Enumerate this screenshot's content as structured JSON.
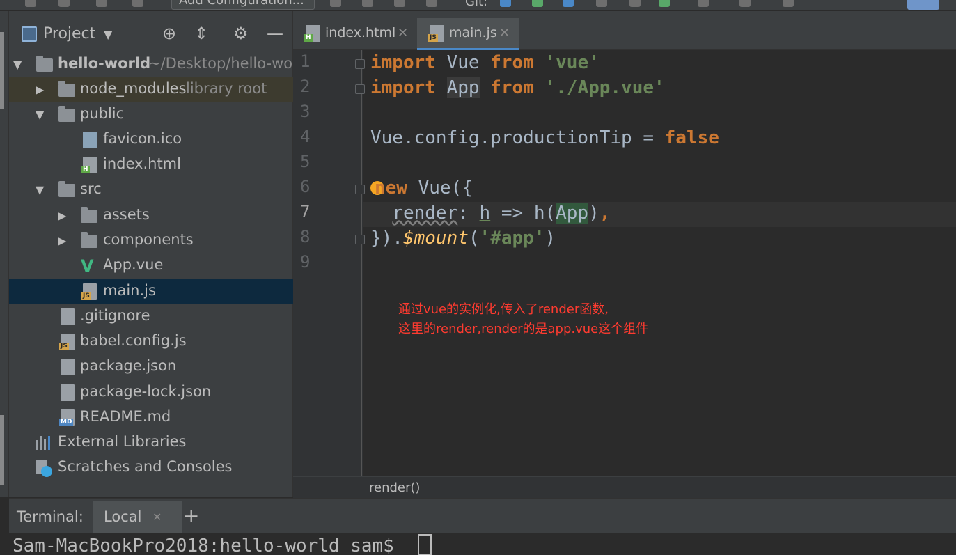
{
  "toolbar": {
    "run_config": "Add Configuration...",
    "git_label": "Git:"
  },
  "project": {
    "title": "Project",
    "tree": {
      "root": {
        "label": "hello-world",
        "hint": "~/Desktop/hello-worl"
      },
      "node_modules": {
        "label": "node_modules",
        "hint": "library root"
      },
      "public": "public",
      "favicon": "favicon.ico",
      "index_html": "index.html",
      "src": "src",
      "assets": "assets",
      "components": "components",
      "app_vue": "App.vue",
      "main_js": "main.js",
      "gitignore": ".gitignore",
      "babel": "babel.config.js",
      "package": "package.json",
      "package_lock": "package-lock.json",
      "readme": "README.md",
      "external": "External Libraries",
      "scratches": "Scratches and Consoles"
    },
    "badges": {
      "js": "JS",
      "h": "H",
      "md": "MD"
    }
  },
  "tabs": [
    {
      "label": "index.html"
    },
    {
      "label": "main.js"
    }
  ],
  "editor": {
    "line_numbers": [
      "1",
      "2",
      "3",
      "4",
      "5",
      "6",
      "7",
      "8",
      "9"
    ],
    "code": {
      "l1": {
        "kw1": "import",
        "id": "Vue",
        "kw2": "from",
        "str": "'vue'"
      },
      "l2": {
        "kw1": "import",
        "id": "App",
        "kw2": "from",
        "str": "'./App.vue'"
      },
      "l4": {
        "expr": "Vue.config.productionTip = ",
        "kw": "false"
      },
      "l6": {
        "kw_start": "n",
        "kw_rest": "ew",
        "rest": " Vue({"
      },
      "l7": {
        "indent": "  ",
        "prop": "render",
        "colon": ": ",
        "param": "h",
        "arrow": " => h(",
        "hl": "App",
        "close": ")",
        "comma": ","
      },
      "l8": {
        "start": "}).",
        "method": "$mount",
        "open": "(",
        "str": "'#app'",
        "close": ")"
      }
    },
    "notes": [
      "通过vue的实例化,传入了render函数,",
      "这里的render,render的是app.vue这个组件"
    ],
    "breadcrumb": "render()"
  },
  "terminal": {
    "title": "Terminal:",
    "tab": "Local",
    "prompt": "Sam-MacBookPro2018:hello-world sam$ "
  },
  "colors": {
    "keyword": "#cc7832",
    "string": "#6a8759",
    "note": "#ff3b30",
    "selection": "#0d293e",
    "vue": "#41b883"
  }
}
